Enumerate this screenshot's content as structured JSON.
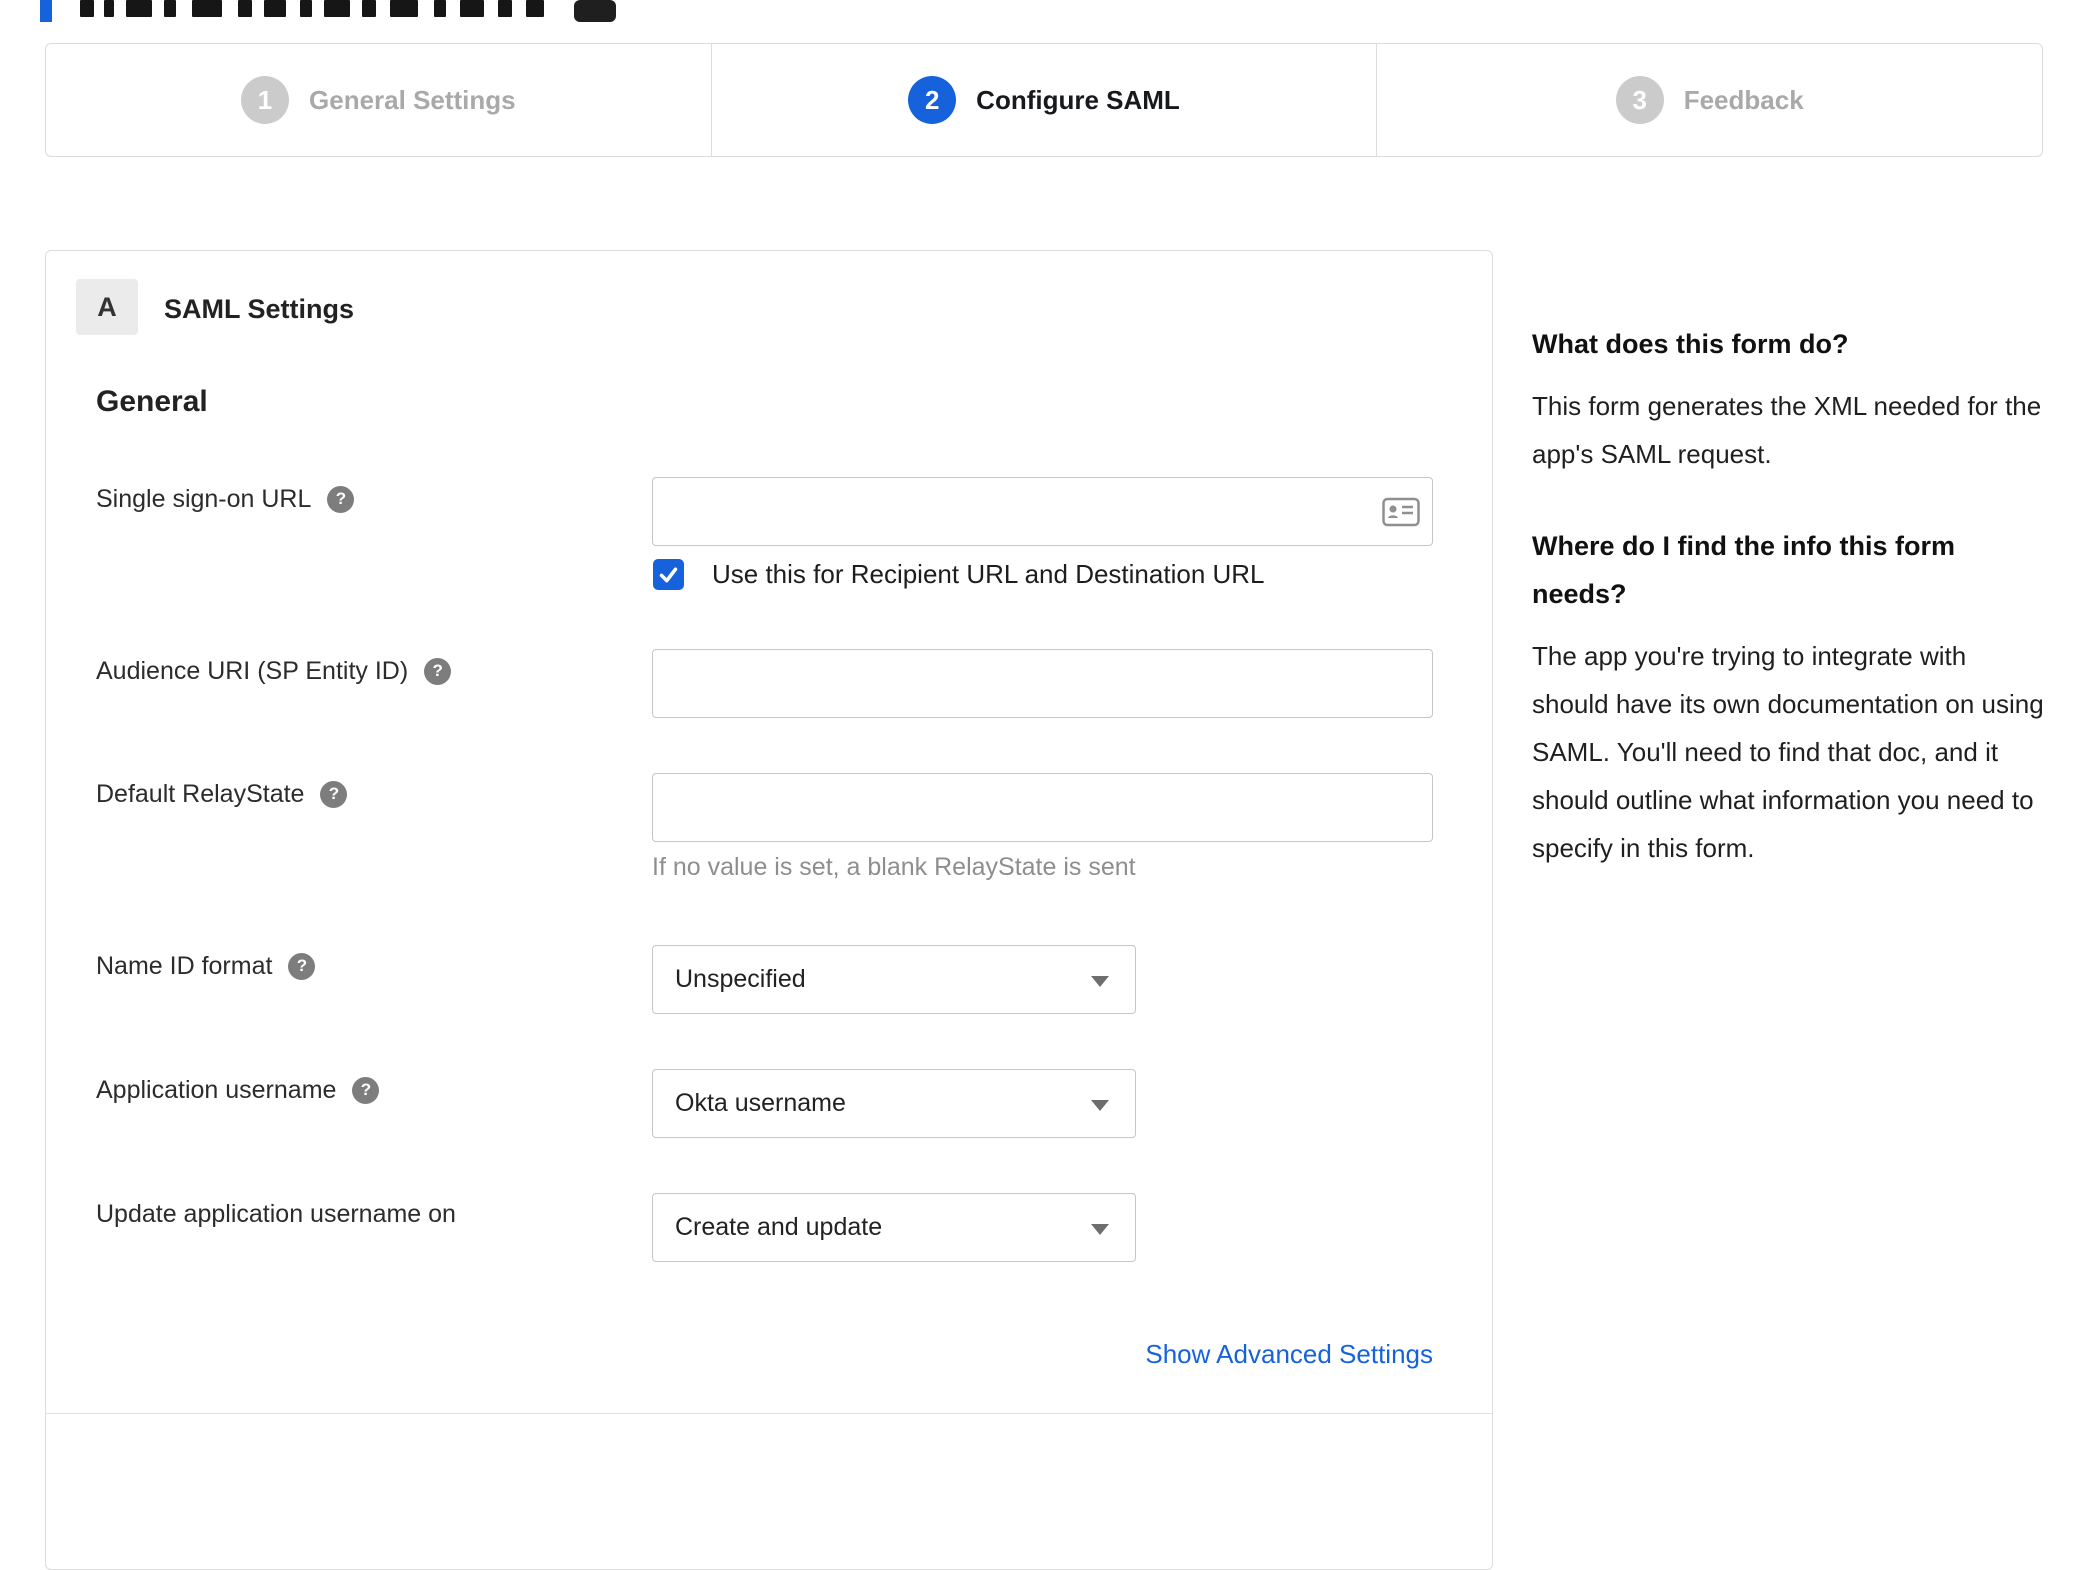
{
  "accent_color": "#1662dd",
  "stepper": {
    "steps": [
      {
        "number": "1",
        "label": "General Settings",
        "active": false
      },
      {
        "number": "2",
        "label": "Configure SAML",
        "active": true
      },
      {
        "number": "3",
        "label": "Feedback",
        "active": false
      }
    ]
  },
  "panel": {
    "badge": "A",
    "title": "SAML Settings",
    "section": "General",
    "fields": {
      "sso": {
        "label": "Single sign-on URL",
        "value": "",
        "checkbox_label": "Use this for Recipient URL and Destination URL",
        "checked": true
      },
      "audience": {
        "label": "Audience URI (SP Entity ID)",
        "value": ""
      },
      "relay": {
        "label": "Default RelayState",
        "value": "",
        "hint": "If no value is set, a blank RelayState is sent"
      },
      "nameid": {
        "label": "Name ID format",
        "value": "Unspecified"
      },
      "appuser": {
        "label": "Application username",
        "value": "Okta username"
      },
      "updateuser": {
        "label": "Update application username on",
        "value": "Create and update"
      }
    },
    "help_icon_glyph": "?",
    "advanced_link": "Show Advanced Settings"
  },
  "help_column": {
    "q1": "What does this form do?",
    "a1": "This form generates the XML needed for the app's SAML request.",
    "q2": "Where do I find the info this form needs?",
    "a2": "The app you're trying to integrate with should have its own documentation on using SAML. You'll need to find that doc, and it should outline what information you need to specify in this form."
  }
}
